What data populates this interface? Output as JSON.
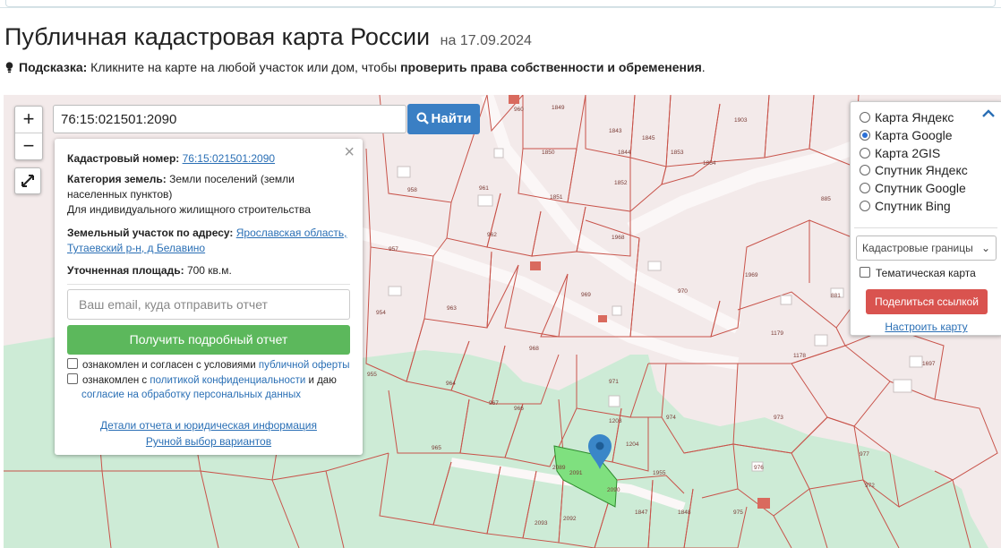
{
  "header": {
    "title": "Публичная кадастровая карта России",
    "date": "на 17.09.2024"
  },
  "hint": {
    "label": "Подсказка:",
    "text": " Кликните на карте на любой участок или дом, чтобы ",
    "bold_text": "проверить права собственности и обременения",
    "end": "."
  },
  "map": {
    "zoom_in": "+",
    "zoom_out": "−",
    "search_value": "76:15:021501:2090",
    "search_button": "Найти",
    "parcel_labels": [
      "960",
      "1849",
      "1843",
      "1844",
      "1845",
      "1903",
      "1850",
      "1853",
      "1854",
      "958",
      "961",
      "1851",
      "1852",
      "885",
      "957",
      "962",
      "1968",
      "1969",
      "963",
      "969",
      "970",
      "881",
      "954",
      "968",
      "1179",
      "1178",
      "1697",
      "955",
      "971",
      "964",
      "967",
      "966",
      "1203",
      "974",
      "973",
      "1204",
      "965",
      "977",
      "972",
      "976",
      "975",
      "2089",
      "2090",
      "1955",
      "2091",
      "2092",
      "2093",
      "1847",
      "1848"
    ],
    "colors": {
      "parcel_border": "#c8534a",
      "parcel_fill": "#f4eded",
      "green_area": "#cdebd6",
      "selected_fill": "#7fe07f",
      "marker": "#3a86c8"
    }
  },
  "popup": {
    "cadastral_label": "Кадастровый номер:",
    "cadastral_value": "76:15:021501:2090",
    "category_label": "Категория земель:",
    "category_value": "Земли поселений (земли населенных пунктов)",
    "usage": "Для индивидуального жилищного строительства",
    "address_label": "Земельный участок по адресу:",
    "address_value": "Ярославская область, Тутаевский р-н, д Белавино",
    "area_label": "Уточненная площадь:",
    "area_value": "700 кв.м.",
    "email_placeholder": "Ваш email, куда отправить отчет",
    "report_button": "Получить подробный отчет",
    "consent1_text": "ознакомлен и согласен с условиями ",
    "consent1_link": "публичной оферты",
    "consent2_text": "ознакомлен с ",
    "consent2_link": "политикой конфиденциальности",
    "consent2_mid": " и даю",
    "consent2_link2": "согласие на обработку персональных данных",
    "details_link": "Детали отчета и юридическая информация",
    "manual_link": "Ручной выбор вариантов",
    "close": "×"
  },
  "layers": {
    "options": [
      {
        "label": "Карта Яндекс",
        "selected": false
      },
      {
        "label": "Карта Google",
        "selected": true
      },
      {
        "label": "Карта 2GIS",
        "selected": false
      },
      {
        "label": "Спутник Яндекс",
        "selected": false
      },
      {
        "label": "Спутник Google",
        "selected": false
      },
      {
        "label": "Спутник Bing",
        "selected": false
      }
    ],
    "boundaries_select": "Кадастровые границы",
    "thematic_label": "Тематическая карта",
    "share_button": "Поделиться ссылкой",
    "configure_link": "Настроить карту"
  }
}
